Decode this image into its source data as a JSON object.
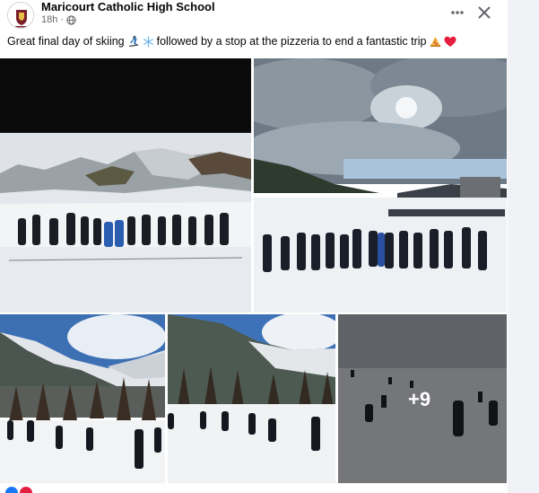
{
  "post": {
    "page_name": "Maricourt Catholic High School",
    "timestamp": "18h",
    "separator": "·",
    "audience_icon": "globe-icon",
    "more_icon": "more-options-icon",
    "close_icon": "close-icon",
    "caption_text_1": "Great final day of skiing",
    "caption_text_2": "followed by a stop at the pizzeria to end a fantastic trip",
    "caption_emojis": [
      "skier-icon",
      "snowflake-icon",
      "pizza-icon",
      "red-heart-icon"
    ]
  },
  "gallery": {
    "extra_photos_label": "+9"
  },
  "colors": {
    "text_primary": "#050505",
    "text_secondary": "#65676b",
    "heart_red": "#e41e3f",
    "background": "#f0f2f5"
  }
}
